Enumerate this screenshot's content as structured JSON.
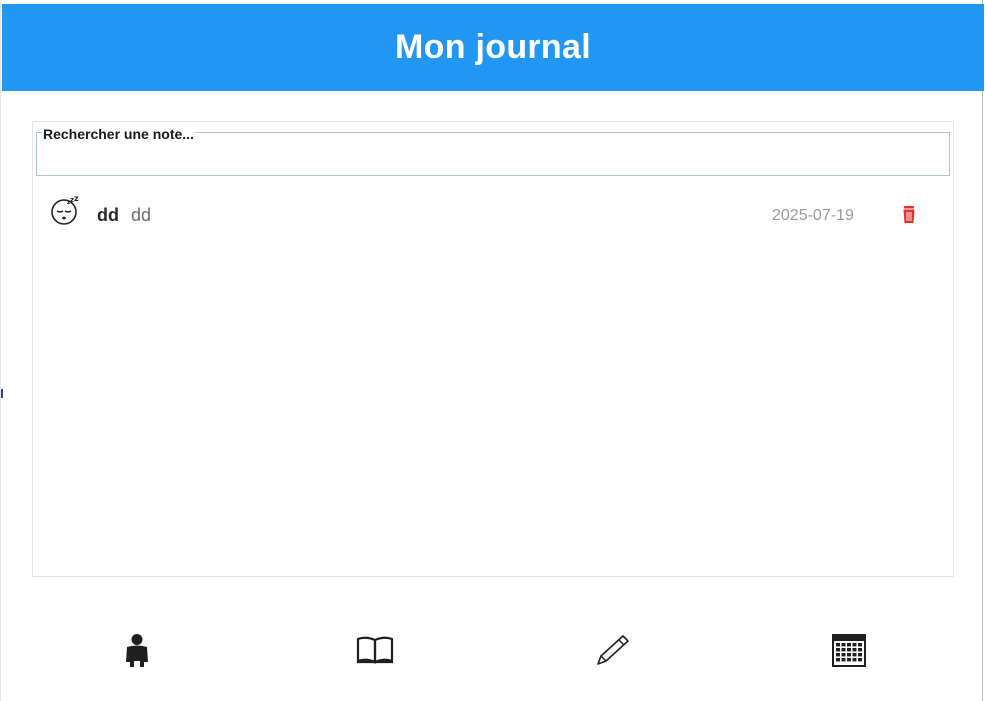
{
  "header": {
    "title": "Mon journal"
  },
  "search": {
    "label": "Rechercher une note...",
    "value": ""
  },
  "notes": [
    {
      "mood_icon": "sleepy-face-icon",
      "title": "dd",
      "body": "dd",
      "date": "2025-07-19",
      "delete_icon": "trash-icon"
    }
  ],
  "bottom_nav": {
    "items": [
      {
        "icon": "person-icon"
      },
      {
        "icon": "book-icon"
      },
      {
        "icon": "pen-icon"
      },
      {
        "icon": "calendar-icon"
      }
    ]
  },
  "colors": {
    "header_bg": "#2196f3",
    "header_text": "#ffffff",
    "delete_red": "#e0312f",
    "search_border": "#a9c4d4"
  }
}
